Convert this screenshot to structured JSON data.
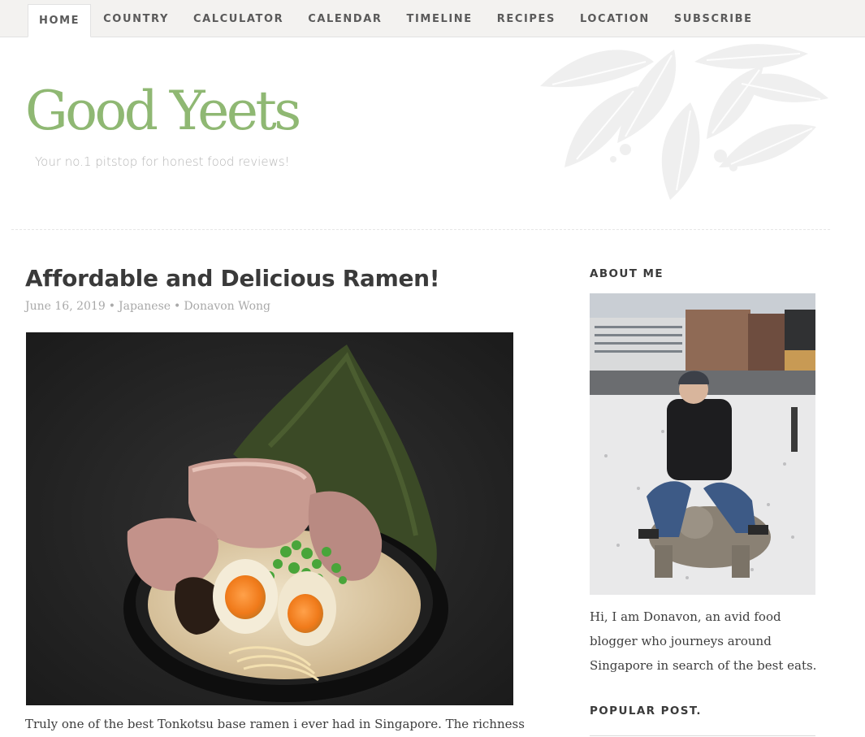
{
  "nav": {
    "items": [
      {
        "label": "HOME",
        "active": true
      },
      {
        "label": "COUNTRY",
        "active": false
      },
      {
        "label": "CALCULATOR",
        "active": false
      },
      {
        "label": "CALENDAR",
        "active": false
      },
      {
        "label": "TIMELINE",
        "active": false
      },
      {
        "label": "RECIPES",
        "active": false
      },
      {
        "label": "LOCATION",
        "active": false
      },
      {
        "label": "SUBSCRIBE",
        "active": false
      }
    ]
  },
  "header": {
    "title": "Good Yeets",
    "tagline": "Your no.1 pitstop for honest food reviews!",
    "decoration_icon": "leaf-wreath-icon"
  },
  "post": {
    "title": "Affordable and Delicious Ramen!",
    "date": "June 16, 2019",
    "category": "Japanese",
    "author": "Donavon Wong",
    "separator": "•",
    "image_subject": "ramen-bowl-photo",
    "excerpt": "Truly one of the best Tonkotsu base ramen i ever had in Singapore. The richness"
  },
  "sidebar": {
    "about_heading": "ABOUT ME",
    "about_photo_subject": "profile-photo",
    "about_text": "Hi, I am Donavon, an avid food blogger who journeys around Singapore in search of the best eats.",
    "popular_heading": "POPULAR POST."
  },
  "colors": {
    "brand_green": "#8fb873",
    "nav_bg": "#f3f2f0",
    "meta_grey": "#a9a9a9"
  }
}
